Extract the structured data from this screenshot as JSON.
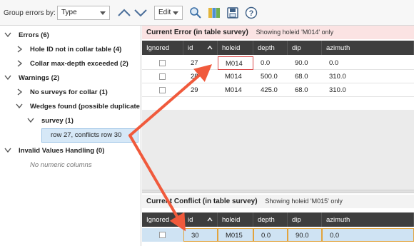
{
  "toolbar": {
    "group_label": "Group errors by:",
    "group_value": "Type",
    "edit_label": "Edit",
    "icons": [
      "collapse-all-icon",
      "expand-all-icon",
      "edit-dropdown",
      "magnify-icon",
      "map-icon",
      "save-icon",
      "help-icon"
    ]
  },
  "tree": {
    "errors": {
      "label": "Errors (6)"
    },
    "hole_id": {
      "label": "Hole ID not in collar table (4)"
    },
    "collar_depth": {
      "label": "Collar max-depth exceeded (2)"
    },
    "warnings": {
      "label": "Warnings (2)"
    },
    "no_surveys": {
      "label": "No surveys for collar (1)"
    },
    "wedges": {
      "label": "Wedges found (possible duplicate ..."
    },
    "survey": {
      "label": "survey (1)"
    },
    "conflict_row": {
      "label": "row 27, conflicts row 30"
    },
    "invalid": {
      "label": "Invalid Values Handling (0)"
    },
    "no_numeric": {
      "label": "No numeric columns"
    }
  },
  "current_error": {
    "title": "Current Error (in table survey)",
    "subtitle": "Showing holeid 'M014' only",
    "headers": [
      "Ignored",
      "id",
      "holeid",
      "depth",
      "dip",
      "azimuth"
    ],
    "rows": [
      [
        "",
        "27",
        "M014",
        "0.0",
        "90.0",
        "0.0"
      ],
      [
        "",
        "28",
        "M014",
        "500.0",
        "68.0",
        "310.0"
      ],
      [
        "",
        "29",
        "M014",
        "425.0",
        "68.0",
        "310.0"
      ]
    ]
  },
  "current_conflict": {
    "title": "Current Conflict (in table survey)",
    "subtitle": "Showing holeid 'M015' only",
    "headers": [
      "Ignored",
      "id",
      "holeid",
      "depth",
      "dip",
      "azimuth"
    ],
    "rows": [
      [
        "",
        "30",
        "M015",
        "0.0",
        "90.0",
        "0.0"
      ]
    ]
  },
  "colors": {
    "arrow": "#f05a3c",
    "header_bg": "#3e3e3e",
    "error_band": "#fbe3e3",
    "selection": "#cfe3f3"
  }
}
